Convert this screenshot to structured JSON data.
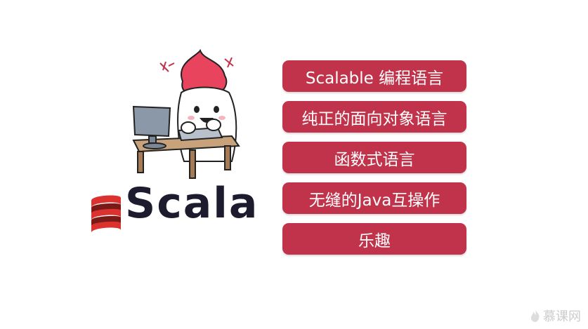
{
  "logo": {
    "wordmark": "Scala",
    "brand_color": "#dc322f"
  },
  "features": [
    {
      "label": "Scalable 编程语言"
    },
    {
      "label": "纯正的面向对象语言"
    },
    {
      "label": "函数式语言"
    },
    {
      "label": "无缝的Java互操作"
    },
    {
      "label": "乐趣"
    }
  ],
  "colors": {
    "feature_bg": "#c1334a",
    "feature_text": "#ffffff",
    "wordmark": "#1c1c2e"
  },
  "watermark": {
    "text": "慕课网",
    "icon": "flame-icon"
  },
  "mascot": {
    "icon": "mascot-at-computer-illustration"
  }
}
